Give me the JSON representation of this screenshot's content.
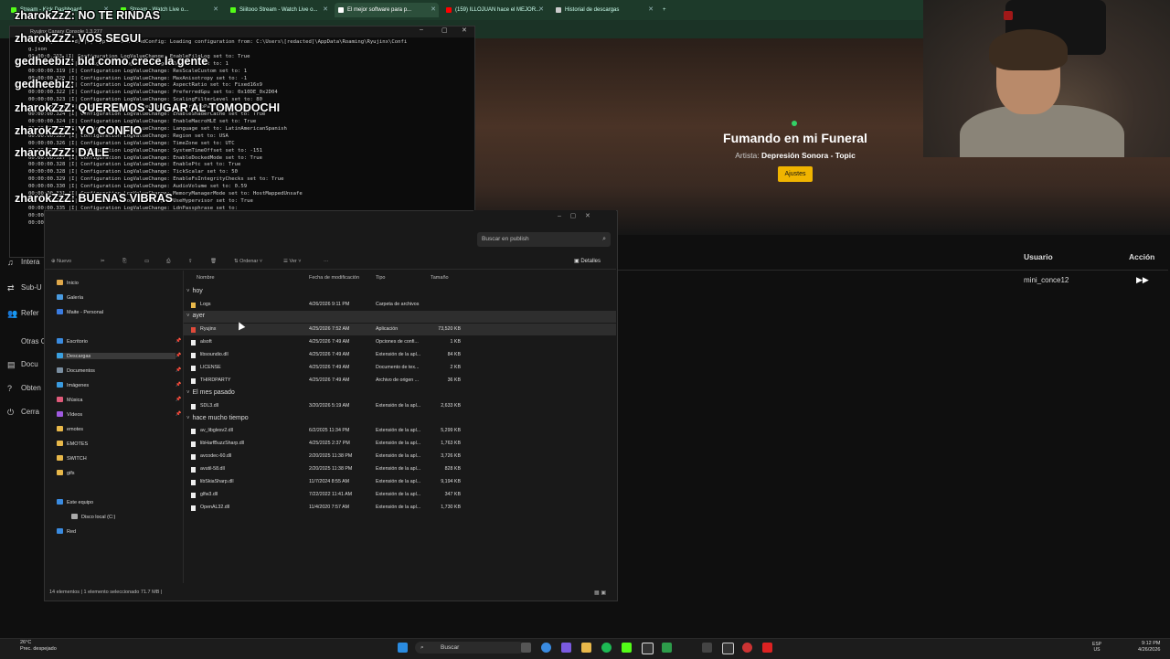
{
  "browser": {
    "tabs": [
      {
        "label": "Stream - Kick Dashboard",
        "active": false,
        "icon_color": "#53fc18"
      },
      {
        "label": "Stream - Watch Live o...",
        "active": false,
        "icon_color": "#53fc18"
      },
      {
        "label": "Siiitooo Stream - Watch Live o...",
        "active": false,
        "icon_color": "#53fc18"
      },
      {
        "label": "El mejor software para p...",
        "active": true,
        "icon_color": "#ffffff"
      },
      {
        "label": "(159) ILLOJUAN hace el MEJOR...",
        "active": false,
        "icon_color": "#ff0000"
      },
      {
        "label": "Historial de descargas",
        "active": false,
        "icon_color": "#cccccc"
      }
    ]
  },
  "chat": [
    {
      "user": "zharokZzZ:",
      "msg": "NO TE RINDAS"
    },
    {
      "user": "zharokZzZ:",
      "msg": "VOS SEGUI"
    },
    {
      "user": "gedheebiz:",
      "msg": "bld como crece la gente"
    },
    {
      "user": "gedheebiz:",
      "msg": ""
    },
    {
      "user": "zharokZzZ:",
      "msg": "QUEREMOS JUGAR AL TOMODOCHI"
    },
    {
      "user": "zharokZzZ:",
      "msg": "YO CONFIO"
    },
    {
      "user": "zharokZzZ:",
      "msg": "DALE"
    },
    {
      "user": "zharokZzZ:",
      "msg": "BUENAS VIBRAS"
    }
  ],
  "console": {
    "title": "Ryujinx Canary Console 1.3.277",
    "lines": [
      "00:00:0[redacted] |L| Application LoadConfig: Loading configuration from: C:\\Users\\[redacted]\\AppData\\Roaming\\Ryujinx\\Confi",
      "g.json",
      "00:00:0.283 |I| Configuration LogValueChange: EnableFileLog set to: True",
      "00:00:00.319 |I| Configuration LogValueChange: ResScale set to: 1",
      "00:00:00.319 |I| Configuration LogValueChange: ResScaleCustom set to: 1",
      "00:00:00.320 |I| Configuration LogValueChange: MaxAnisotropy set to: -1",
      "00:00:00.320 |I| Configuration LogValueChange: AspectRatio set to: Fixed16x9",
      "00:00:00.322 |I| Configuration LogValueChange: PreferredGpu set to: 0x10DE_0x2D04",
      "00:00:00.323 |I| Configuration LogValueChange: ScalingFilterLevel set to: 80",
      "00:00:00.323 |I| Configuration LogValueChange: ShaderDumpPath set to: 128",
      "00:00:00.324 |I| Configuration LogValueChange: EnableShaderCache set to: True",
      "00:00:00.324 |I| Configuration LogValueChange: EnableMacroHLE set to: True",
      "00:00:00.325 |I| Configuration LogValueChange: Language set to: LatinAmericanSpanish",
      "00:00:00.325 |I| Configuration LogValueChange: Region set to: USA",
      "00:00:00.326 |I| Configuration LogValueChange: TimeZone set to: UTC",
      "00:00:00.327 |I| Configuration LogValueChange: SystemTimeOffset set to: -151",
      "00:00:00.327 |I| Configuration LogValueChange: EnableDockedMode set to: True",
      "00:00:00.328 |I| Configuration LogValueChange: EnablePtc set to: True",
      "00:00:00.328 |I| Configuration LogValueChange: TickScalar set to: 50",
      "00:00:00.329 |I| Configuration LogValueChange: EnableFsIntegrityChecks set to: True",
      "00:00:00.330 |I| Configuration LogValueChange: AudioVolume set to: 0.59",
      "00:00:00.331 |I| Configuration LogValueChange: MemoryManagerMode set to: HostMappedUnsafe",
      "00:00:00.333 |I| Configuration LogValueChange: UseHypervisor set to: True",
      "00:00:00.335 |I| Configuration LogValueChange: LdnPassphrase set to:",
      "00:00:00.336 |I| Configuration LogValueChange: LdnServer set to:",
      "00:00:00.336 |I| Configuration LogValueChange: GdbStubPort set to: 55555"
    ]
  },
  "site_nav": [
    "Intera",
    "Sub-U",
    "Refer",
    "Otras Opci",
    "Docu",
    "Obten",
    "Cerra"
  ],
  "song": {
    "title": "Fumando en mi Funeral",
    "artist_label": "Artista:",
    "artist": "Depresión Sonora - Topic",
    "button": "Ajustes"
  },
  "user_table": {
    "col_user": "Usuario",
    "col_action": "Acción",
    "user": "mini_conce12"
  },
  "explorer": {
    "search_placeholder": "Buscar en publish",
    "toolbar": {
      "new": "Nuevo",
      "sort": "Ordenar",
      "view": "Ver",
      "more": "···",
      "details": "Detalles"
    },
    "columns": {
      "name": "Nombre",
      "modified": "Fecha de modificación",
      "type": "Tipo",
      "size": "Tamaño"
    },
    "sidebar": [
      {
        "label": "Inicio",
        "color": "#e0a84a"
      },
      {
        "label": "Galería",
        "color": "#4a9be0"
      },
      {
        "label": "Maite - Personal",
        "color": "#3a7be0"
      },
      {
        "label": "Escritorio",
        "color": "#3a8be0"
      },
      {
        "label": "Descargas",
        "color": "#3aa0e0"
      },
      {
        "label": "Documentos",
        "color": "#7a8ea0"
      },
      {
        "label": "Imágenes",
        "color": "#3a9be0"
      },
      {
        "label": "Música",
        "color": "#e05a7a"
      },
      {
        "label": "Vídeos",
        "color": "#a05ae0"
      },
      {
        "label": "emotes",
        "color": "#e8b84a"
      },
      {
        "label": "EMOTES",
        "color": "#e8b84a"
      },
      {
        "label": "SWITCH",
        "color": "#e8b84a"
      },
      {
        "label": "gifs",
        "color": "#e8b84a"
      },
      {
        "label": "Este equipo",
        "color": "#3a8be0"
      },
      {
        "label": "Disco local (C:)",
        "color": "#aaaaaa"
      },
      {
        "label": "Red",
        "color": "#3a8be0"
      }
    ],
    "groups": {
      "today": "hoy",
      "yesterday": "ayer",
      "last_month": "El mes pasado",
      "long_ago": "hace mucho tiempo"
    },
    "files_today": [
      {
        "name": "Logs",
        "date": "4/26/2026 9:11 PM",
        "type": "Carpeta de archivos",
        "size": "",
        "kind": "folder"
      }
    ],
    "files_yesterday": [
      {
        "name": "Ryujinx",
        "date": "4/25/2026 7:52 AM",
        "type": "Aplicación",
        "size": "73,520 KB",
        "kind": "app"
      },
      {
        "name": "alsoft",
        "date": "4/25/2026 7:49 AM",
        "type": "Opciones de confi...",
        "size": "1 KB",
        "kind": "file"
      },
      {
        "name": "libsoundio.dll",
        "date": "4/25/2026 7:49 AM",
        "type": "Extensión de la apl...",
        "size": "84 KB",
        "kind": "file"
      },
      {
        "name": "LICENSE",
        "date": "4/25/2026 7:49 AM",
        "type": "Documento de tex...",
        "size": "2 KB",
        "kind": "file"
      },
      {
        "name": "THIRDPARTY",
        "date": "4/25/2026 7:49 AM",
        "type": "Archivo de origen ...",
        "size": "36 KB",
        "kind": "file"
      }
    ],
    "files_last_month": [
      {
        "name": "SDL3.dll",
        "date": "3/20/2026 5:19 AM",
        "type": "Extensión de la apl...",
        "size": "2,633 KB",
        "kind": "file"
      }
    ],
    "files_long_ago": [
      {
        "name": "av_libglesv2.dll",
        "date": "6/2/2025 11:34 PM",
        "type": "Extensión de la apl...",
        "size": "5,299 KB",
        "kind": "file"
      },
      {
        "name": "libHarfBuzzSharp.dll",
        "date": "4/25/2025 2:37 PM",
        "type": "Extensión de la apl...",
        "size": "1,763 KB",
        "kind": "file"
      },
      {
        "name": "avcodec-60.dll",
        "date": "2/20/2025 11:38 PM",
        "type": "Extensión de la apl...",
        "size": "3,726 KB",
        "kind": "file"
      },
      {
        "name": "avutil-58.dll",
        "date": "2/20/2025 11:38 PM",
        "type": "Extensión de la apl...",
        "size": "828 KB",
        "kind": "file"
      },
      {
        "name": "libSkiaSharp.dll",
        "date": "11/7/2024 8:55 AM",
        "type": "Extensión de la apl...",
        "size": "9,194 KB",
        "kind": "file"
      },
      {
        "name": "glfw3.dll",
        "date": "7/22/2022 11:41 AM",
        "type": "Extensión de la apl...",
        "size": "347 KB",
        "kind": "file"
      },
      {
        "name": "OpenAL32.dll",
        "date": "11/4/2020 7:57 AM",
        "type": "Extensión de la apl...",
        "size": "1,730 KB",
        "kind": "file"
      }
    ],
    "status": "14 elementos  |  1 elemento seleccionado 71.7 MB  |"
  },
  "taskbar": {
    "weather_temp": "26°C",
    "weather_desc": "Prec. despejado",
    "search": "Buscar",
    "lang1": "ESP",
    "lang2": "US",
    "time": "9:12 PM",
    "date": "4/26/2026"
  }
}
